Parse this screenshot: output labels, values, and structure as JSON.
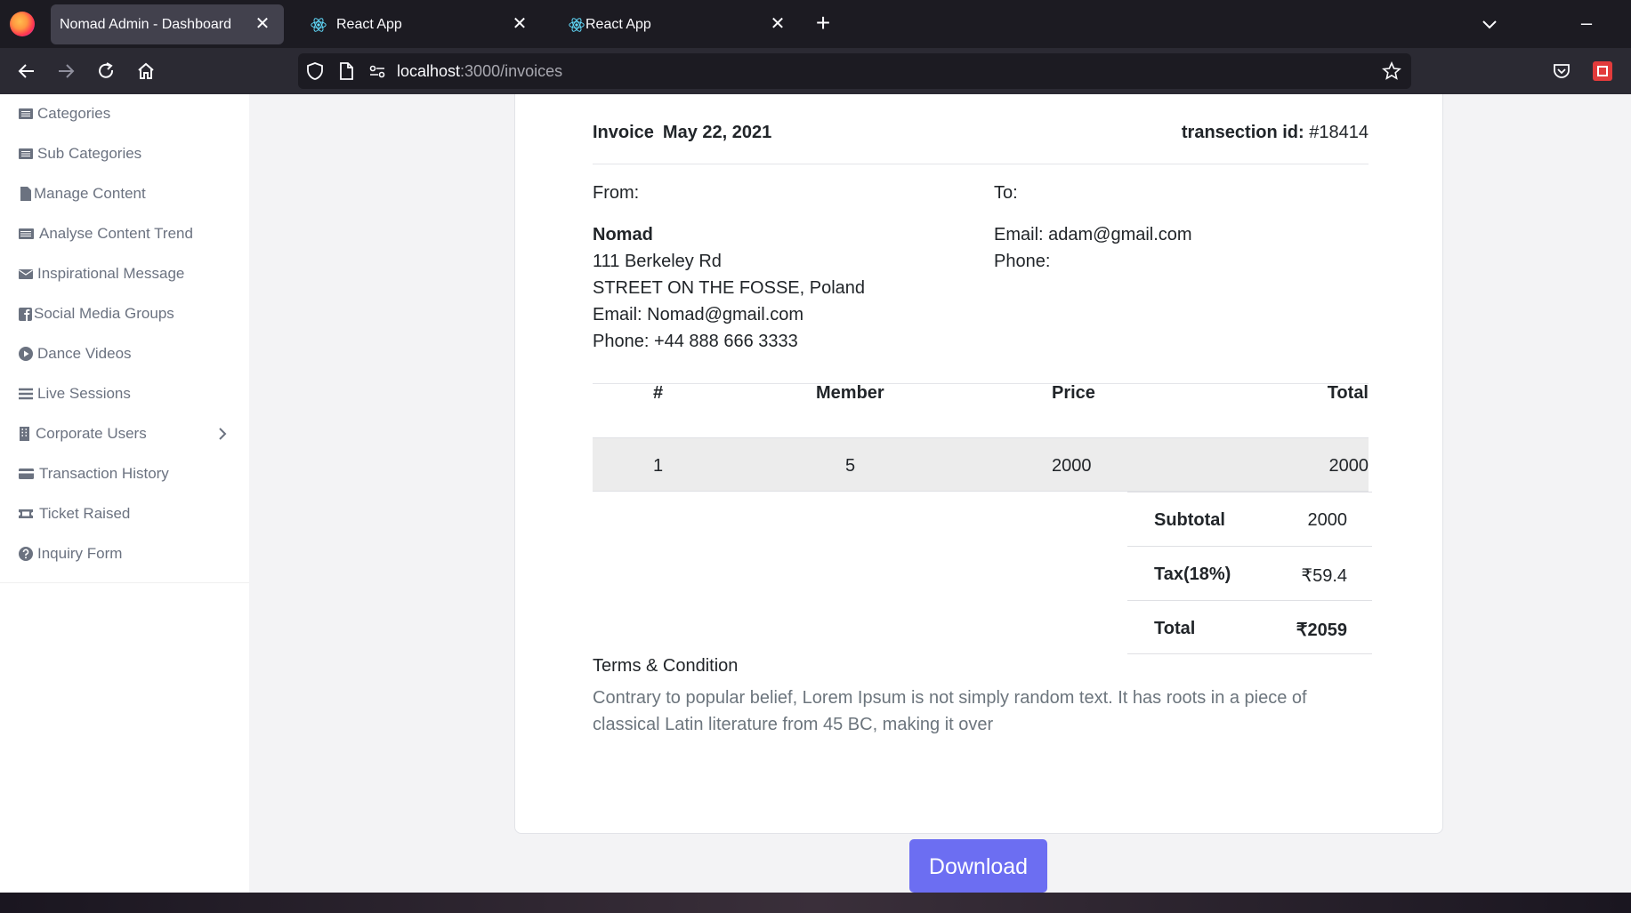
{
  "browser": {
    "tabs": [
      {
        "title": "Nomad Admin - Dashboard",
        "active": true
      },
      {
        "title": "React App",
        "active": false
      },
      {
        "title": "React App",
        "active": false
      }
    ],
    "close_glyph": "✕",
    "new_tab_glyph": "+",
    "minimize_glyph": "–",
    "url_host": "localhost",
    "url_path": ":3000/invoices"
  },
  "sidebar": {
    "items": [
      {
        "label": "Categories",
        "icon": "list-icon"
      },
      {
        "label": "Sub Categories",
        "icon": "list-icon"
      },
      {
        "label": "Manage Content",
        "icon": "file-icon"
      },
      {
        "label": "Analyse Content Trend",
        "icon": "list-alt-icon"
      },
      {
        "label": "Inspirational Message",
        "icon": "envelope-icon"
      },
      {
        "label": "Social Media Groups",
        "icon": "facebook-icon"
      },
      {
        "label": "Dance Videos",
        "icon": "play-circle-icon"
      },
      {
        "label": "Live Sessions",
        "icon": "bars-icon"
      },
      {
        "label": "Corporate Users",
        "icon": "building-icon"
      },
      {
        "label": "Transaction History",
        "icon": "credit-card-icon"
      },
      {
        "label": "Ticket Raised",
        "icon": "ticket-icon"
      },
      {
        "label": "Inquiry Form",
        "icon": "question-circle-icon"
      }
    ]
  },
  "invoice": {
    "title": "Invoice",
    "date": "May 22, 2021",
    "transaction_label": "transection id:",
    "transaction_id": "#18414",
    "from_label": "From:",
    "to_label": "To:",
    "from": {
      "name": "Nomad",
      "address1": "111 Berkeley Rd",
      "address2": "STREET ON THE FOSSE, Poland",
      "email": "Email: Nomad@gmail.com",
      "phone": "Phone: +44 888 666 3333"
    },
    "to": {
      "email": "Email: adam@gmail.com",
      "phone": "Phone:"
    },
    "table": {
      "headers": [
        "#",
        "Member",
        "Price",
        "Total"
      ],
      "rows": [
        [
          "1",
          "5",
          "2000",
          "2000"
        ]
      ]
    },
    "summary": {
      "subtotal_label": "Subtotal",
      "subtotal": "2000",
      "tax_label": "Tax(18%)",
      "tax": "₹59.4",
      "total_label": "Total",
      "total": "₹2059"
    },
    "terms_title": "Terms & Condition",
    "terms_text": "Contrary to popular belief, Lorem Ipsum is not simply random text. It has roots in a piece of classical Latin literature from 45 BC, making it over"
  },
  "download_label": "Download",
  "colors": {
    "accent": "#6c6ef2",
    "chrome_dark": "#1c1b22",
    "chrome": "#2b2a33"
  }
}
